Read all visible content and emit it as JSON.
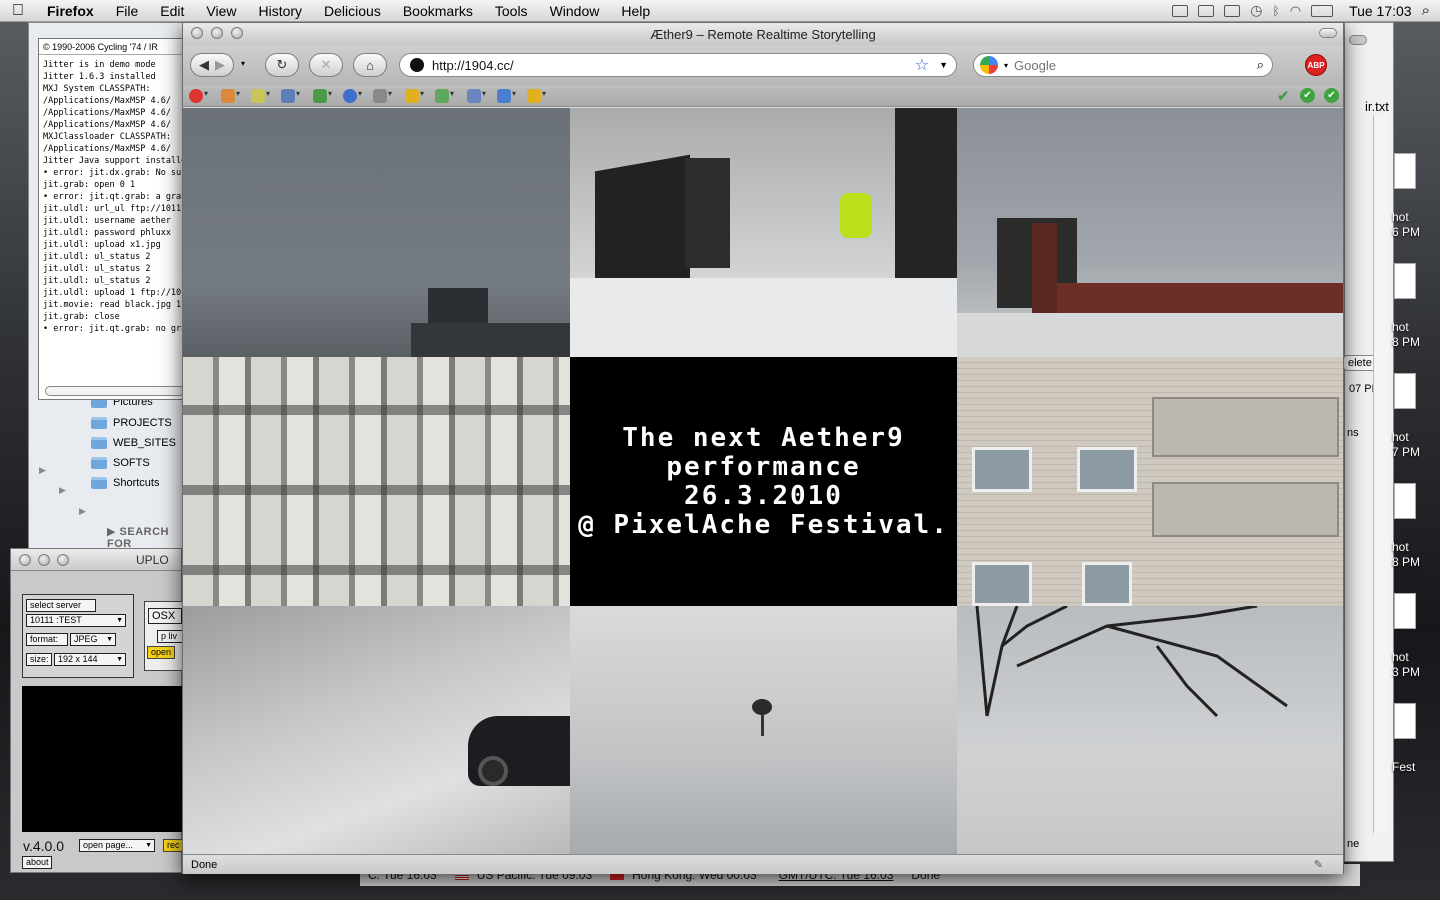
{
  "menubar": {
    "app": "Firefox",
    "items": [
      "File",
      "Edit",
      "View",
      "History",
      "Delicious",
      "Bookmarks",
      "Tools",
      "Window",
      "Help"
    ],
    "clock": "Tue 17:03",
    "icons": [
      "spaces-icon",
      "display-icon",
      "calendar-icon",
      "time-machine-icon",
      "bluetooth-icon",
      "wifi-icon",
      "battery-icon",
      "spotlight-icon"
    ]
  },
  "console": {
    "copyright": "© 1990-2006 Cycling '74 / IR",
    "lines": [
      "Jitter is in demo mode",
      "Jitter 1.6.3 installed",
      "MXJ System CLASSPATH:",
      "  /Applications/MaxMSP 4.6/",
      "  /Applications/MaxMSP 4.6/",
      "  /Applications/MaxMSP 4.6/",
      "MXJClassloader CLASSPATH:",
      "  /Applications/MaxMSP 4.6/",
      "Jitter Java support installed",
      "• error: jit.dx.grab: No such o",
      "jit.grab: open 0 1",
      "• error: jit.qt.grab: a grabber",
      "jit.uldl: url_ul ftp://10111.or",
      "jit.uldl: username aether",
      "jit.uldl: password phluxx",
      "jit.uldl: upload x1.jpg",
      "jit.uldl: ul_status 2",
      "jit.uldl: ul_status 2",
      "jit.uldl: ul_status 2",
      "jit.uldl: upload 1 ftp://10111.",
      "jit.movie: read black.jpg 1",
      "jit.grab: close",
      "• error: jit.qt.grab: no grabber"
    ]
  },
  "finder": {
    "items": [
      "Pictures",
      "PROJECTS",
      "WEB_SITES",
      "SOFTS",
      "Shortcuts"
    ],
    "search_for": "SEARCH FOR"
  },
  "upload": {
    "title": "UPLO",
    "select_server": "select server",
    "server": "10111 :TEST",
    "format_label": "format:",
    "format": "JPEG",
    "size_label": "size:",
    "size": "192 x 144",
    "osx": "OSX",
    "p_live": "p liv",
    "open": "open",
    "version": "v.4.0.0",
    "open_page": "open page...",
    "rec": "rec",
    "about": "about"
  },
  "firefox": {
    "title": "Æther9 – Remote Realtime Storytelling",
    "url": "http://1904.cc/",
    "search_placeholder": "Google",
    "abp": "ABP",
    "status": "Done",
    "announcement": [
      "The next Aether9",
      "performance",
      "26.3.2010",
      "@ PixelAche Festival."
    ]
  },
  "right_window": {
    "labels": [
      "ir.txt",
      "elete",
      "07 PM",
      "ns",
      "ne"
    ]
  },
  "desktop_files": [
    {
      "name": "hot",
      "time": "6 PM"
    },
    {
      "name": "hot",
      "time": "8 PM"
    },
    {
      "name": "hot",
      "time": "7 PM"
    },
    {
      "name": "hot",
      "time": "8 PM"
    },
    {
      "name": "hot",
      "time": "3 PM"
    },
    {
      "name": "Fest",
      "time": ""
    }
  ],
  "clocks": {
    "utc_partial": "C: Tue 16:03",
    "us_pacific": "US Pacific: Tue 09:03",
    "hong_kong": "Hong Kong: Wed 00:03",
    "gmt": "GMT/UTC: Tue 16:03",
    "done": "Done"
  }
}
